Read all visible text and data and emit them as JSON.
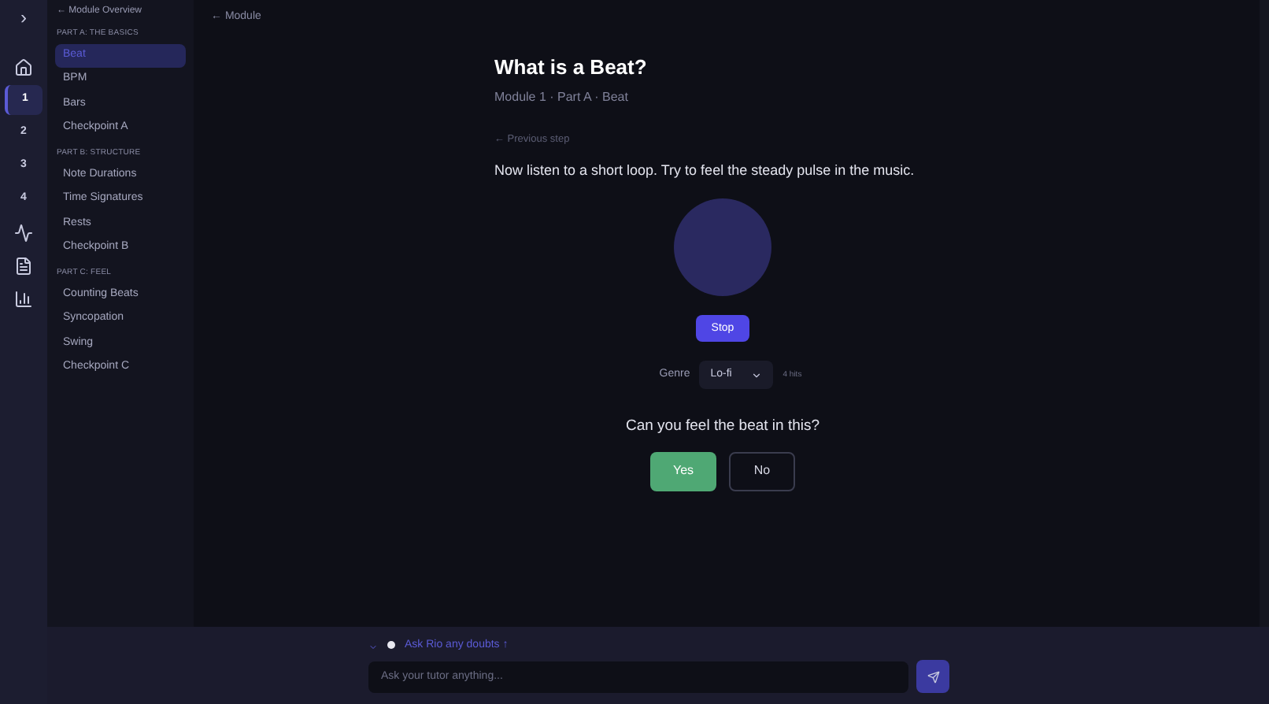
{
  "rail": {
    "toggle": "›",
    "items": [
      {
        "kind": "home",
        "selected": false
      },
      {
        "kind": "number",
        "label": "1",
        "selected": true
      },
      {
        "kind": "number",
        "label": "2",
        "selected": false
      },
      {
        "kind": "number",
        "label": "3",
        "selected": false
      },
      {
        "kind": "number",
        "label": "4",
        "selected": false
      },
      {
        "kind": "activity",
        "selected": false
      },
      {
        "kind": "document",
        "selected": false
      },
      {
        "kind": "chart",
        "selected": false
      }
    ]
  },
  "sidebar": {
    "back_link": "← Module Overview",
    "sections": [
      {
        "title": "PART A: THE BASICS",
        "items": [
          {
            "label": "Beat",
            "selected": true
          },
          {
            "label": "BPM",
            "selected": false
          },
          {
            "label": "Bars",
            "selected": false
          },
          {
            "label": "Checkpoint A",
            "selected": false
          }
        ]
      },
      {
        "title": "PART B: STRUCTURE",
        "items": [
          {
            "label": "Note Durations",
            "selected": false
          },
          {
            "label": "Time Signatures",
            "selected": false
          },
          {
            "label": "Rests",
            "selected": false
          },
          {
            "label": "Checkpoint B",
            "selected": false
          }
        ]
      },
      {
        "title": "PART C: FEEL",
        "items": [
          {
            "label": "Counting Beats",
            "selected": false
          },
          {
            "label": "Syncopation",
            "selected": false
          },
          {
            "label": "Swing",
            "selected": false
          },
          {
            "label": "Checkpoint C",
            "selected": false
          }
        ]
      }
    ]
  },
  "main": {
    "back_link": "← Module",
    "title": "What is a Beat?",
    "subtitle": "Module 1 · Part A · Beat",
    "previous_step": "← Previous step",
    "instruction": "Now listen to a short loop. Try to feel the steady pulse in the music.",
    "stop_button": "Stop",
    "genre": {
      "label": "Genre",
      "value": "Lo-fi",
      "hint": "4 hits"
    },
    "question": "Can you feel the beat in this?",
    "answers": [
      "Yes",
      "No"
    ]
  },
  "tutor": {
    "prompt": "Ask Rio any doubts ↑",
    "placeholder": "Ask your tutor anything..."
  }
}
